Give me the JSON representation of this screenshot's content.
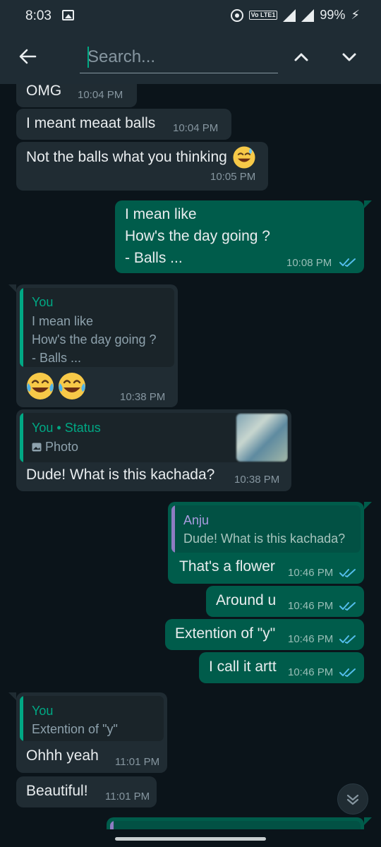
{
  "status_bar": {
    "time": "8:03",
    "volte": "Vo LTE1",
    "battery": "99%"
  },
  "search": {
    "placeholder": "Search..."
  },
  "colors": {
    "incoming": "#202c33",
    "outgoing": "#005c4b",
    "accent": "#00a884",
    "you_author": "#00a884",
    "anju_author": "#8e7cc3",
    "tick": "#53bdeb"
  },
  "messages": [
    {
      "text": "OMG",
      "time": "10:04 PM"
    },
    {
      "text": "I meant meaat balls",
      "time": "10:04 PM"
    },
    {
      "text": "Not the balls what you thinking",
      "time": "10:05 PM"
    },
    {
      "text": "I mean like\nHow's the day going ?\n - Balls ...",
      "time": "10:08 PM"
    },
    {
      "quote_author": "You",
      "quote_text": "I mean like\nHow's the day going ?\n - Balls ...",
      "time": "10:38 PM"
    },
    {
      "quote_author": "You",
      "quote_sep": "•",
      "quote_status": "Status",
      "quote_media": "Photo",
      "text": "Dude! What is this kachada?",
      "time": "10:38 PM"
    },
    {
      "quote_author": "Anju",
      "quote_text": "Dude! What is this kachada?",
      "text": "That's a flower",
      "time": "10:46 PM"
    },
    {
      "text": "Around u",
      "time": "10:46 PM"
    },
    {
      "text": "Extention of \"y\"",
      "time": "10:46 PM"
    },
    {
      "text": "I call it artt",
      "time": "10:46 PM"
    },
    {
      "quote_author": "You",
      "quote_text": "Extention of \"y\"",
      "text": "Ohhh yeah",
      "time": "11:01 PM"
    },
    {
      "text": "Beautiful!",
      "time": "11:01 PM"
    }
  ]
}
